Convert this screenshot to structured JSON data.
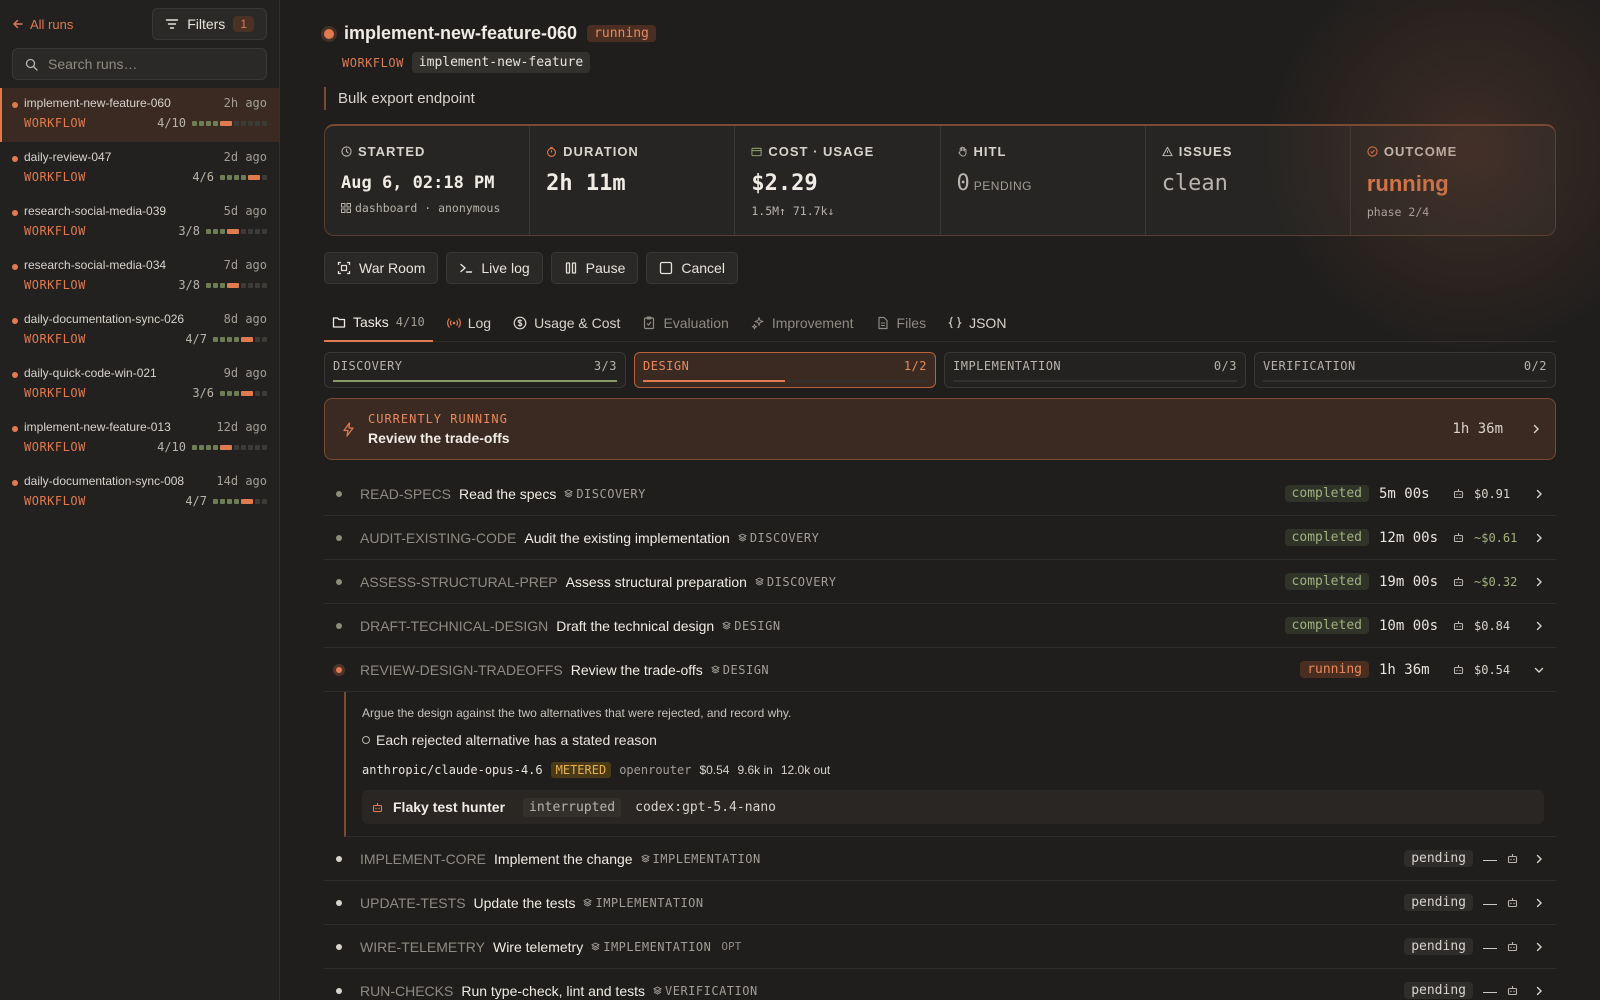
{
  "sidebar": {
    "back_label": "All runs",
    "filters_label": "Filters",
    "filters_count": "1",
    "search_placeholder": "Search runs…",
    "runs": [
      {
        "name": "implement-new-feature-060",
        "ago": "2h ago",
        "kind": "WORKFLOW",
        "progress": "4/10",
        "done": 4,
        "total": 10
      },
      {
        "name": "daily-review-047",
        "ago": "2d ago",
        "kind": "WORKFLOW",
        "progress": "4/6",
        "done": 4,
        "total": 6
      },
      {
        "name": "research-social-media-039",
        "ago": "5d ago",
        "kind": "WORKFLOW",
        "progress": "3/8",
        "done": 3,
        "total": 8
      },
      {
        "name": "research-social-media-034",
        "ago": "7d ago",
        "kind": "WORKFLOW",
        "progress": "3/8",
        "done": 3,
        "total": 8
      },
      {
        "name": "daily-documentation-sync-026",
        "ago": "8d ago",
        "kind": "WORKFLOW",
        "progress": "4/7",
        "done": 4,
        "total": 7
      },
      {
        "name": "daily-quick-code-win-021",
        "ago": "9d ago",
        "kind": "WORKFLOW",
        "progress": "3/6",
        "done": 3,
        "total": 6
      },
      {
        "name": "implement-new-feature-013",
        "ago": "12d ago",
        "kind": "WORKFLOW",
        "progress": "4/10",
        "done": 4,
        "total": 10
      },
      {
        "name": "daily-documentation-sync-008",
        "ago": "14d ago",
        "kind": "WORKFLOW",
        "progress": "4/7",
        "done": 4,
        "total": 7
      }
    ]
  },
  "header": {
    "title": "implement-new-feature-060",
    "status": "running",
    "workflow_label": "WORKFLOW",
    "workflow_name": "implement-new-feature",
    "description": "Bulk export endpoint"
  },
  "stats": {
    "started": {
      "label": "STARTED",
      "value": "Aug 6, 02:18 PM",
      "sub": "dashboard · anonymous"
    },
    "duration": {
      "label": "DURATION",
      "value": "2h 11m"
    },
    "cost": {
      "label": "COST · USAGE",
      "value": "$2.29",
      "sub": "1.5M↑ 71.7k↓"
    },
    "hitl": {
      "label": "HITL",
      "value": "0",
      "sub": "PENDING"
    },
    "issues": {
      "label": "ISSUES",
      "value": "clean"
    },
    "outcome": {
      "label": "OUTCOME",
      "value": "running",
      "sub": "phase 2/4"
    }
  },
  "actions": {
    "war_room": "War Room",
    "live_log": "Live log",
    "pause": "Pause",
    "cancel": "Cancel"
  },
  "tabs": {
    "tasks": "Tasks",
    "tasks_count": "4/10",
    "log": "Log",
    "usage": "Usage & Cost",
    "evaluation": "Evaluation",
    "improvement": "Improvement",
    "files": "Files",
    "json": "JSON"
  },
  "phases": [
    {
      "name": "DISCOVERY",
      "progress": "3/3",
      "fraction": 1.0
    },
    {
      "name": "DESIGN",
      "progress": "1/2",
      "fraction": 0.5
    },
    {
      "name": "IMPLEMENTATION",
      "progress": "0/3",
      "fraction": 0
    },
    {
      "name": "VERIFICATION",
      "progress": "0/2",
      "fraction": 0
    }
  ],
  "current": {
    "label": "CURRENTLY RUNNING",
    "name": "Review the trade-offs",
    "time": "1h 36m"
  },
  "tasks": [
    {
      "id": "READ-SPECS",
      "name": "Read the specs",
      "phase": "DISCOVERY",
      "status": "completed",
      "dur": "5m 00s",
      "cost": "$0.91"
    },
    {
      "id": "AUDIT-EXISTING-CODE",
      "name": "Audit the existing implementation",
      "phase": "DISCOVERY",
      "status": "completed",
      "dur": "12m 00s",
      "cost": "~$0.61"
    },
    {
      "id": "ASSESS-STRUCTURAL-PREP",
      "name": "Assess structural preparation",
      "phase": "DISCOVERY",
      "status": "completed",
      "dur": "19m 00s",
      "cost": "~$0.32"
    },
    {
      "id": "DRAFT-TECHNICAL-DESIGN",
      "name": "Draft the technical design",
      "phase": "DESIGN",
      "status": "completed",
      "dur": "10m 00s",
      "cost": "$0.84"
    },
    {
      "id": "REVIEW-DESIGN-TRADEOFFS",
      "name": "Review the trade-offs",
      "phase": "DESIGN",
      "status": "running",
      "dur": "1h 36m",
      "cost": "$0.54"
    }
  ],
  "expanded": {
    "description": "Argue the design against the two alternatives that were rejected, and record why.",
    "criterion": "Each rejected alternative has a stated reason",
    "model": "anthropic/claude-opus-4.6",
    "billing": "METERED",
    "provider": "openrouter",
    "cost": "$0.54",
    "tokens_in": "9.6k in",
    "tokens_out": "12.0k out",
    "agent_name": "Flaky test hunter",
    "agent_state": "interrupted",
    "agent_model": "codex:gpt-5.4-nano"
  },
  "pending_tasks": [
    {
      "id": "IMPLEMENT-CORE",
      "name": "Implement the change",
      "phase": "IMPLEMENTATION",
      "status": "pending",
      "dur": "—"
    },
    {
      "id": "UPDATE-TESTS",
      "name": "Update the tests",
      "phase": "IMPLEMENTATION",
      "status": "pending",
      "dur": "—"
    },
    {
      "id": "WIRE-TELEMETRY",
      "name": "Wire telemetry",
      "phase": "IMPLEMENTATION",
      "status": "pending",
      "dur": "—",
      "opt": "OPT"
    },
    {
      "id": "RUN-CHECKS",
      "name": "Run type-check, lint and tests",
      "phase": "VERIFICATION",
      "status": "pending",
      "dur": "—"
    }
  ],
  "colors": {
    "accent": "#e07a4f",
    "done": "#6f7d55",
    "bg": "#1f1e1d"
  }
}
